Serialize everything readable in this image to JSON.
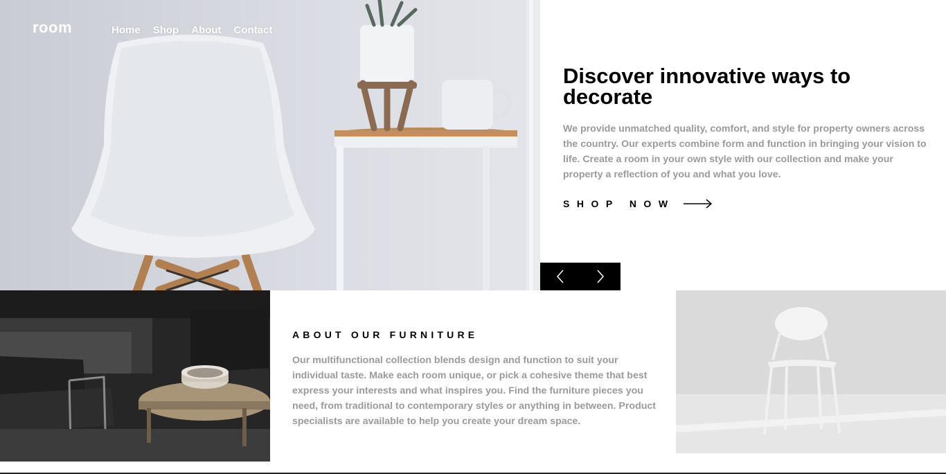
{
  "nav": {
    "logo": "room",
    "links": [
      {
        "label": "Home"
      },
      {
        "label": "Shop"
      },
      {
        "label": "About"
      },
      {
        "label": "Contact"
      }
    ]
  },
  "hero": {
    "title": "Discover innovative ways to decorate",
    "description": "We provide unmatched quality, comfort, and style for property owners across the country. Our experts combine form and function in bringing your vision to life. Create a room in your own style with our collection and make your property a reflection of you and what you love.",
    "cta_label": "SHOP NOW",
    "cta_icon": "arrow-right-icon",
    "slider": {
      "prev_icon": "chevron-left-icon",
      "next_icon": "chevron-right-icon"
    }
  },
  "about": {
    "title": "ABOUT OUR FURNITURE",
    "description": "Our multifunctional collection blends design and function to suit your individual taste. Make each room unique, or pick a cohesive theme that best express your interests and what inspires you. Find the furniture pieces you need, from traditional to contemporary styles or anything in between. Product specialists are available to help you create your dream space."
  },
  "colors": {
    "text_primary": "#000000",
    "text_muted": "#9a9a9a",
    "nav_text": "#ffffff",
    "slider_bg": "#000000"
  }
}
